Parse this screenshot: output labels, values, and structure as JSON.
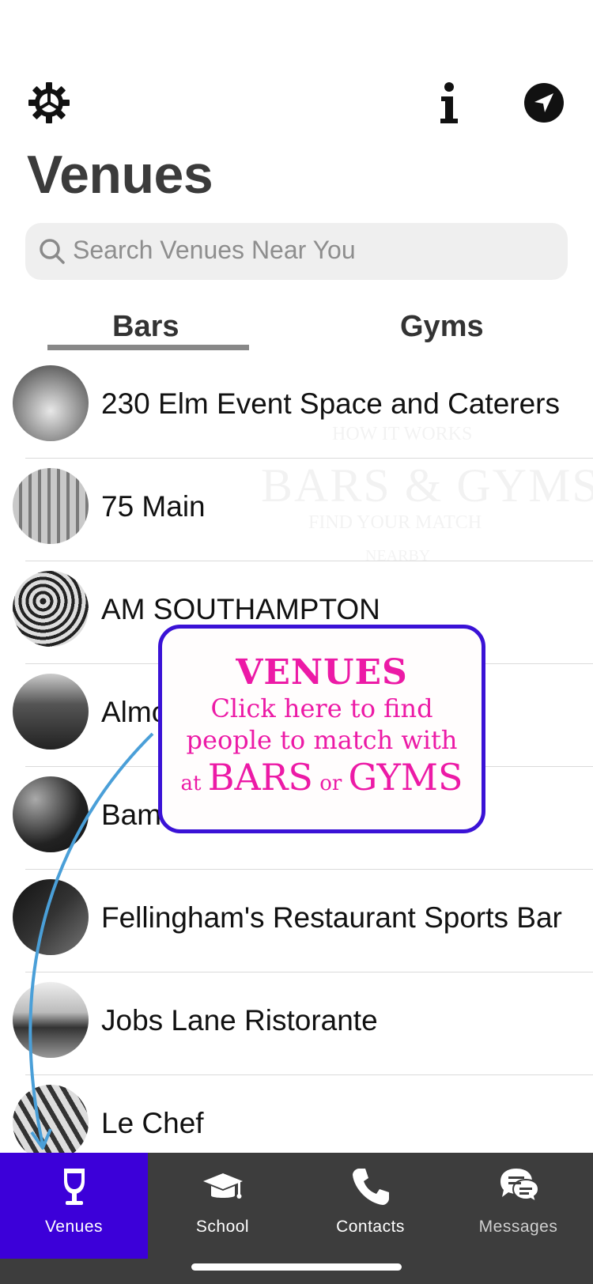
{
  "header": {
    "title": "Venues",
    "info_label": "i"
  },
  "search": {
    "placeholder": "Search Venues Near You"
  },
  "tabs": {
    "bars": "Bars",
    "gyms": "Gyms",
    "selected": "Bars"
  },
  "venues": [
    {
      "name": "230 Elm Event Space and Caterers"
    },
    {
      "name": "75 Main"
    },
    {
      "name": "AM SOUTHAMPTON"
    },
    {
      "name": "Almo"
    },
    {
      "name": "Bam"
    },
    {
      "name": "Fellingham's Restaurant Sports Bar"
    },
    {
      "name": "Jobs Lane Ristorante"
    },
    {
      "name": "Le Chef"
    }
  ],
  "watermark": {
    "line1": "HOW IT WORKS",
    "line2": "BARS & GYMS",
    "line3": "FIND YOUR MATCH",
    "line4": "NEARBY"
  },
  "callout": {
    "heading": "VENUES",
    "line1": "Click here to find",
    "line2": "people to match with",
    "at": "at",
    "bars": "BARS",
    "or": "or",
    "gyms": "GYMS"
  },
  "tabbar": {
    "venues": "Venues",
    "school": "School",
    "contacts": "Contacts",
    "messages": "Messages",
    "active": "Venues"
  },
  "colors": {
    "accent": "#3c00d9",
    "callout_text": "#ec1aa6",
    "callout_border": "#3a12d6",
    "tabbar_bg": "#3d3d3d",
    "arrow": "#4a9fd8"
  },
  "icons": {
    "gear": "gear-icon",
    "info": "info-icon",
    "location": "location-arrow-icon",
    "search": "search-icon",
    "venues": "wine-glass-icon",
    "school": "graduation-cap-icon",
    "contacts": "phone-icon",
    "messages": "chat-bubbles-icon"
  }
}
